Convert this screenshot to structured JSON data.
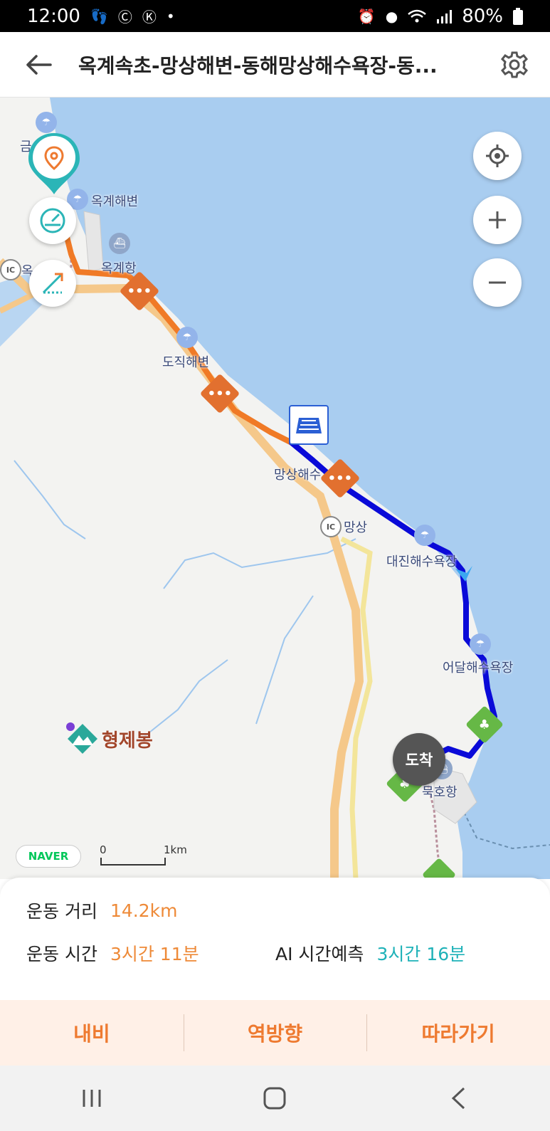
{
  "status_bar": {
    "time": "12:00",
    "battery": "80%",
    "left_icons": [
      "steps-icon",
      "c-icon",
      "k-icon",
      "dot-icon"
    ],
    "right_icons": [
      "alarm-icon",
      "location-icon",
      "wifi-icon",
      "signal-icon",
      "battery-icon"
    ]
  },
  "header": {
    "title": "옥계속초-망상해변-동해망상해수욕장-동..."
  },
  "map": {
    "labels": {
      "okgye_beach": "옥계해변",
      "okgye_port": "옥계항",
      "dojik_beach": "도직해변",
      "mangsang_beach": "망상해수",
      "mangsang_ic": "망상",
      "daejin_beach": "대진해수욕장",
      "eodal_beach": "어달해수욕장",
      "mukho_port": "묵호항",
      "hyeongjebong": "형제봉",
      "ic_text": "IC",
      "partial_top": "금",
      "partial_left": "옥"
    },
    "arrival": "도착",
    "naver": "NAVER",
    "scale_start": "0",
    "scale_end": "1km",
    "route_colors": {
      "done": "#f07a26",
      "planned": "#0a0ad8"
    },
    "water_color": "#a9cdf0"
  },
  "stats": {
    "distance_label": "운동 거리",
    "distance_value": "14.2km",
    "time_label": "운동 시간",
    "time_value": "3시간 11분",
    "ai_label": "AI 시간예측",
    "ai_value": "3시간 16분"
  },
  "actions": {
    "navi": "내비",
    "reverse": "역방향",
    "follow": "따라가기"
  }
}
